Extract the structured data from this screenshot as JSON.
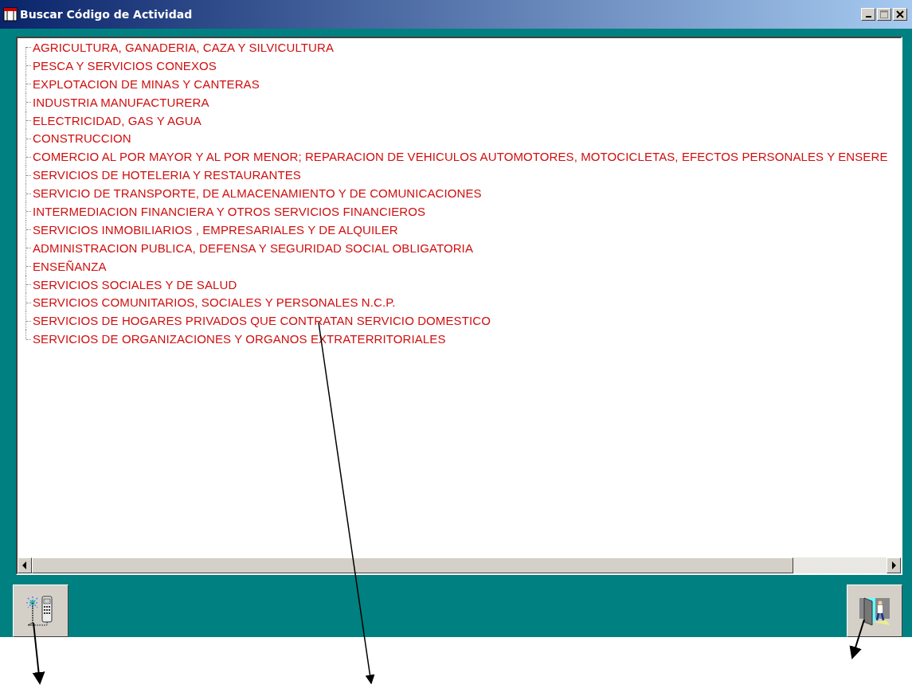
{
  "window": {
    "title": "Buscar Código de Actividad"
  },
  "tree": {
    "items": [
      {
        "label": "AGRICULTURA, GANADERIA, CAZA Y SILVICULTURA"
      },
      {
        "label": "PESCA Y SERVICIOS CONEXOS"
      },
      {
        "label": "EXPLOTACION DE MINAS Y CANTERAS"
      },
      {
        "label": "INDUSTRIA MANUFACTURERA"
      },
      {
        "label": "ELECTRICIDAD, GAS Y AGUA"
      },
      {
        "label": "CONSTRUCCION"
      },
      {
        "label": "COMERCIO AL POR MAYOR Y AL POR MENOR; REPARACION DE VEHICULOS AUTOMOTORES, MOTOCICLETAS, EFECTOS PERSONALES Y ENSERE"
      },
      {
        "label": "SERVICIOS DE HOTELERIA Y RESTAURANTES"
      },
      {
        "label": "SERVICIO DE TRANSPORTE, DE ALMACENAMIENTO Y DE COMUNICACIONES"
      },
      {
        "label": "INTERMEDIACION FINANCIERA Y OTROS SERVICIOS FINANCIEROS"
      },
      {
        "label": "SERVICIOS INMOBILIARIOS , EMPRESARIALES Y DE ALQUILER"
      },
      {
        "label": "ADMINISTRACION PUBLICA, DEFENSA Y SEGURIDAD SOCIAL OBLIGATORIA"
      },
      {
        "label": "ENSEÑANZA"
      },
      {
        "label": "SERVICIOS SOCIALES Y DE SALUD"
      },
      {
        "label": "SERVICIOS COMUNITARIOS, SOCIALES Y PERSONALES N.C.P."
      },
      {
        "label": "SERVICIOS DE HOGARES PRIVADOS QUE CONTRATAN SERVICIO DOMESTICO"
      },
      {
        "label": "SERVICIOS DE ORGANIZACIONES Y ORGANOS EXTRATERRITORIALES"
      }
    ]
  }
}
